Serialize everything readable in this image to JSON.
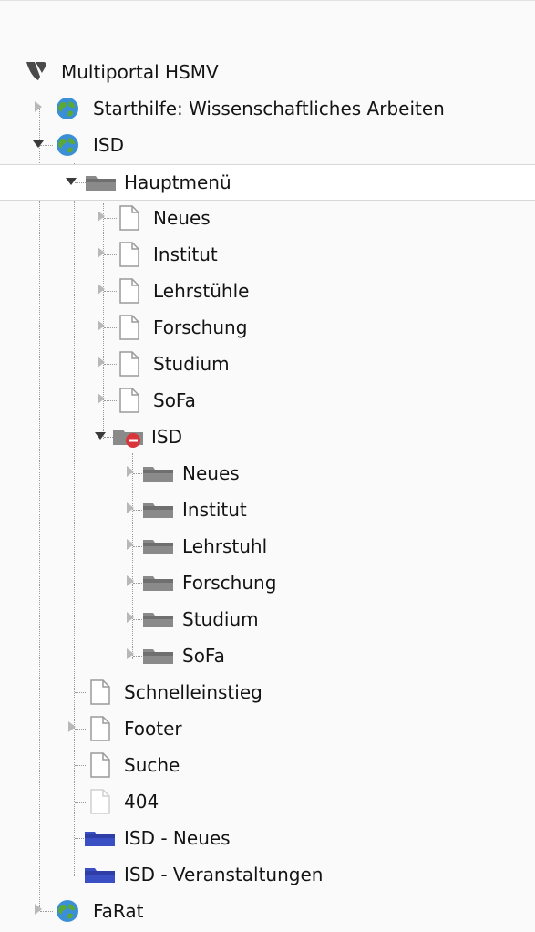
{
  "tree": {
    "root": {
      "label": "Multiportal HSMV",
      "icon": "typo3-logo-icon"
    },
    "nodes": [
      {
        "label": "Starthilfe: Wissenschaftliches Arbeiten",
        "icon": "globe-icon",
        "toggle": "collapsed"
      },
      {
        "label": "ISD",
        "icon": "globe-icon",
        "toggle": "expanded"
      },
      {
        "label": "Hauptmenü",
        "icon": "folder-gray-icon",
        "toggle": "expanded",
        "selected": true
      },
      {
        "label": "Neues",
        "icon": "page-icon",
        "toggle": "collapsed"
      },
      {
        "label": "Institut",
        "icon": "page-icon",
        "toggle": "collapsed"
      },
      {
        "label": "Lehrstühle",
        "icon": "page-icon",
        "toggle": "collapsed"
      },
      {
        "label": "Forschung",
        "icon": "page-icon",
        "toggle": "collapsed"
      },
      {
        "label": "Studium",
        "icon": "page-icon",
        "toggle": "collapsed"
      },
      {
        "label": "SoFa",
        "icon": "page-icon",
        "toggle": "collapsed"
      },
      {
        "label": "ISD",
        "icon": "folder-hidden-icon",
        "toggle": "expanded"
      },
      {
        "label": "Neues",
        "icon": "folder-gray-icon",
        "toggle": "collapsed"
      },
      {
        "label": "Institut",
        "icon": "folder-gray-icon",
        "toggle": "collapsed"
      },
      {
        "label": "Lehrstuhl",
        "icon": "folder-gray-icon",
        "toggle": "collapsed"
      },
      {
        "label": "Forschung",
        "icon": "folder-gray-icon",
        "toggle": "collapsed"
      },
      {
        "label": "Studium",
        "icon": "folder-gray-icon",
        "toggle": "collapsed"
      },
      {
        "label": "SoFa",
        "icon": "folder-gray-icon",
        "toggle": "collapsed"
      },
      {
        "label": "Schnelleinstieg",
        "icon": "page-icon",
        "toggle": "none"
      },
      {
        "label": "Footer",
        "icon": "page-icon",
        "toggle": "collapsed"
      },
      {
        "label": "Suche",
        "icon": "page-icon",
        "toggle": "none"
      },
      {
        "label": "404",
        "icon": "page-faded-icon",
        "toggle": "none"
      },
      {
        "label": "ISD - Neues",
        "icon": "folder-blue-icon",
        "toggle": "none"
      },
      {
        "label": "ISD - Veranstaltungen",
        "icon": "folder-blue-icon",
        "toggle": "none"
      },
      {
        "label": "FaRat",
        "icon": "globe-icon",
        "toggle": "collapsed"
      }
    ]
  },
  "colors": {
    "globe_blue": "#3a8fd6",
    "globe_green": "#5aa838",
    "folder_gray": "#8a8a8a",
    "folder_blue": "#3b4fc4",
    "hidden_badge": "#d9343a",
    "selected_background": "#ffffff"
  }
}
